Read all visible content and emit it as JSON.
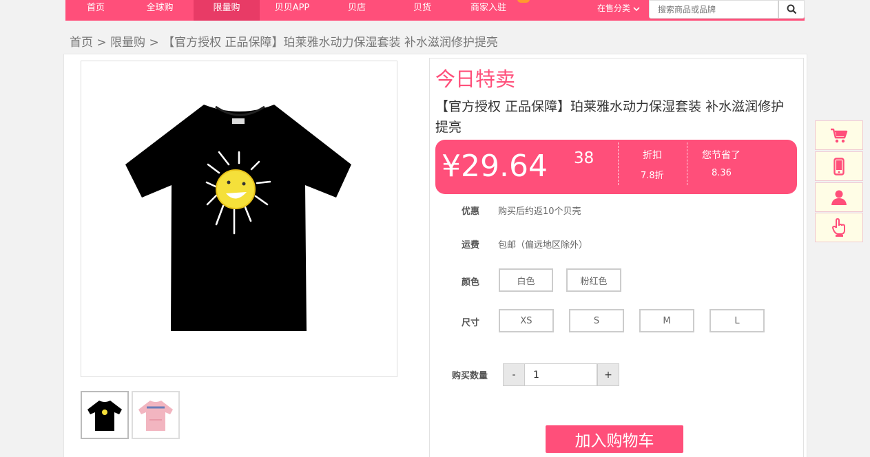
{
  "nav": {
    "items": [
      {
        "label": "首页"
      },
      {
        "label": "全球购"
      },
      {
        "label": "限量购"
      },
      {
        "label": "贝贝APP"
      },
      {
        "label": "贝店"
      },
      {
        "label": "贝货"
      },
      {
        "label": "商家入驻"
      }
    ],
    "active_index": 2,
    "category_label": "在售分类",
    "search_placeholder": "搜索商品或品牌"
  },
  "breadcrumb": {
    "text": "首页 > 限量购 > 【官方授权 正品保障】珀莱雅水动力保湿套装 补水滋润修护提亮"
  },
  "product": {
    "badge": "今日特卖",
    "title": "【官方授权 正品保障】珀莱雅水动力保湿套装 补水滋润修护提亮",
    "price": "¥29.64",
    "price_extra": "38",
    "discount_label": "折扣",
    "discount_value": "7.8折",
    "saved_label": "您节省了",
    "saved_value": "8.36",
    "promo_label": "优惠",
    "promo_value": "购买后约返10个贝壳",
    "shipping_label": "运费",
    "shipping_value": "包邮（偏远地区除外）",
    "color_label": "颜色",
    "colors": [
      "白色",
      "粉红色"
    ],
    "size_label": "尺寸",
    "sizes": [
      "XS",
      "S",
      "M",
      "L"
    ],
    "qty_label": "购买数量",
    "qty_minus": "-",
    "qty_value": "1",
    "qty_plus": "+",
    "add_to_cart": "加入购物车"
  },
  "colors": {
    "brand_pink": "#ff4f7a",
    "nav_active": "#e83b66"
  },
  "side_toolbar": [
    "cart-icon",
    "phone-icon",
    "user-icon",
    "hand-pointer-icon"
  ]
}
